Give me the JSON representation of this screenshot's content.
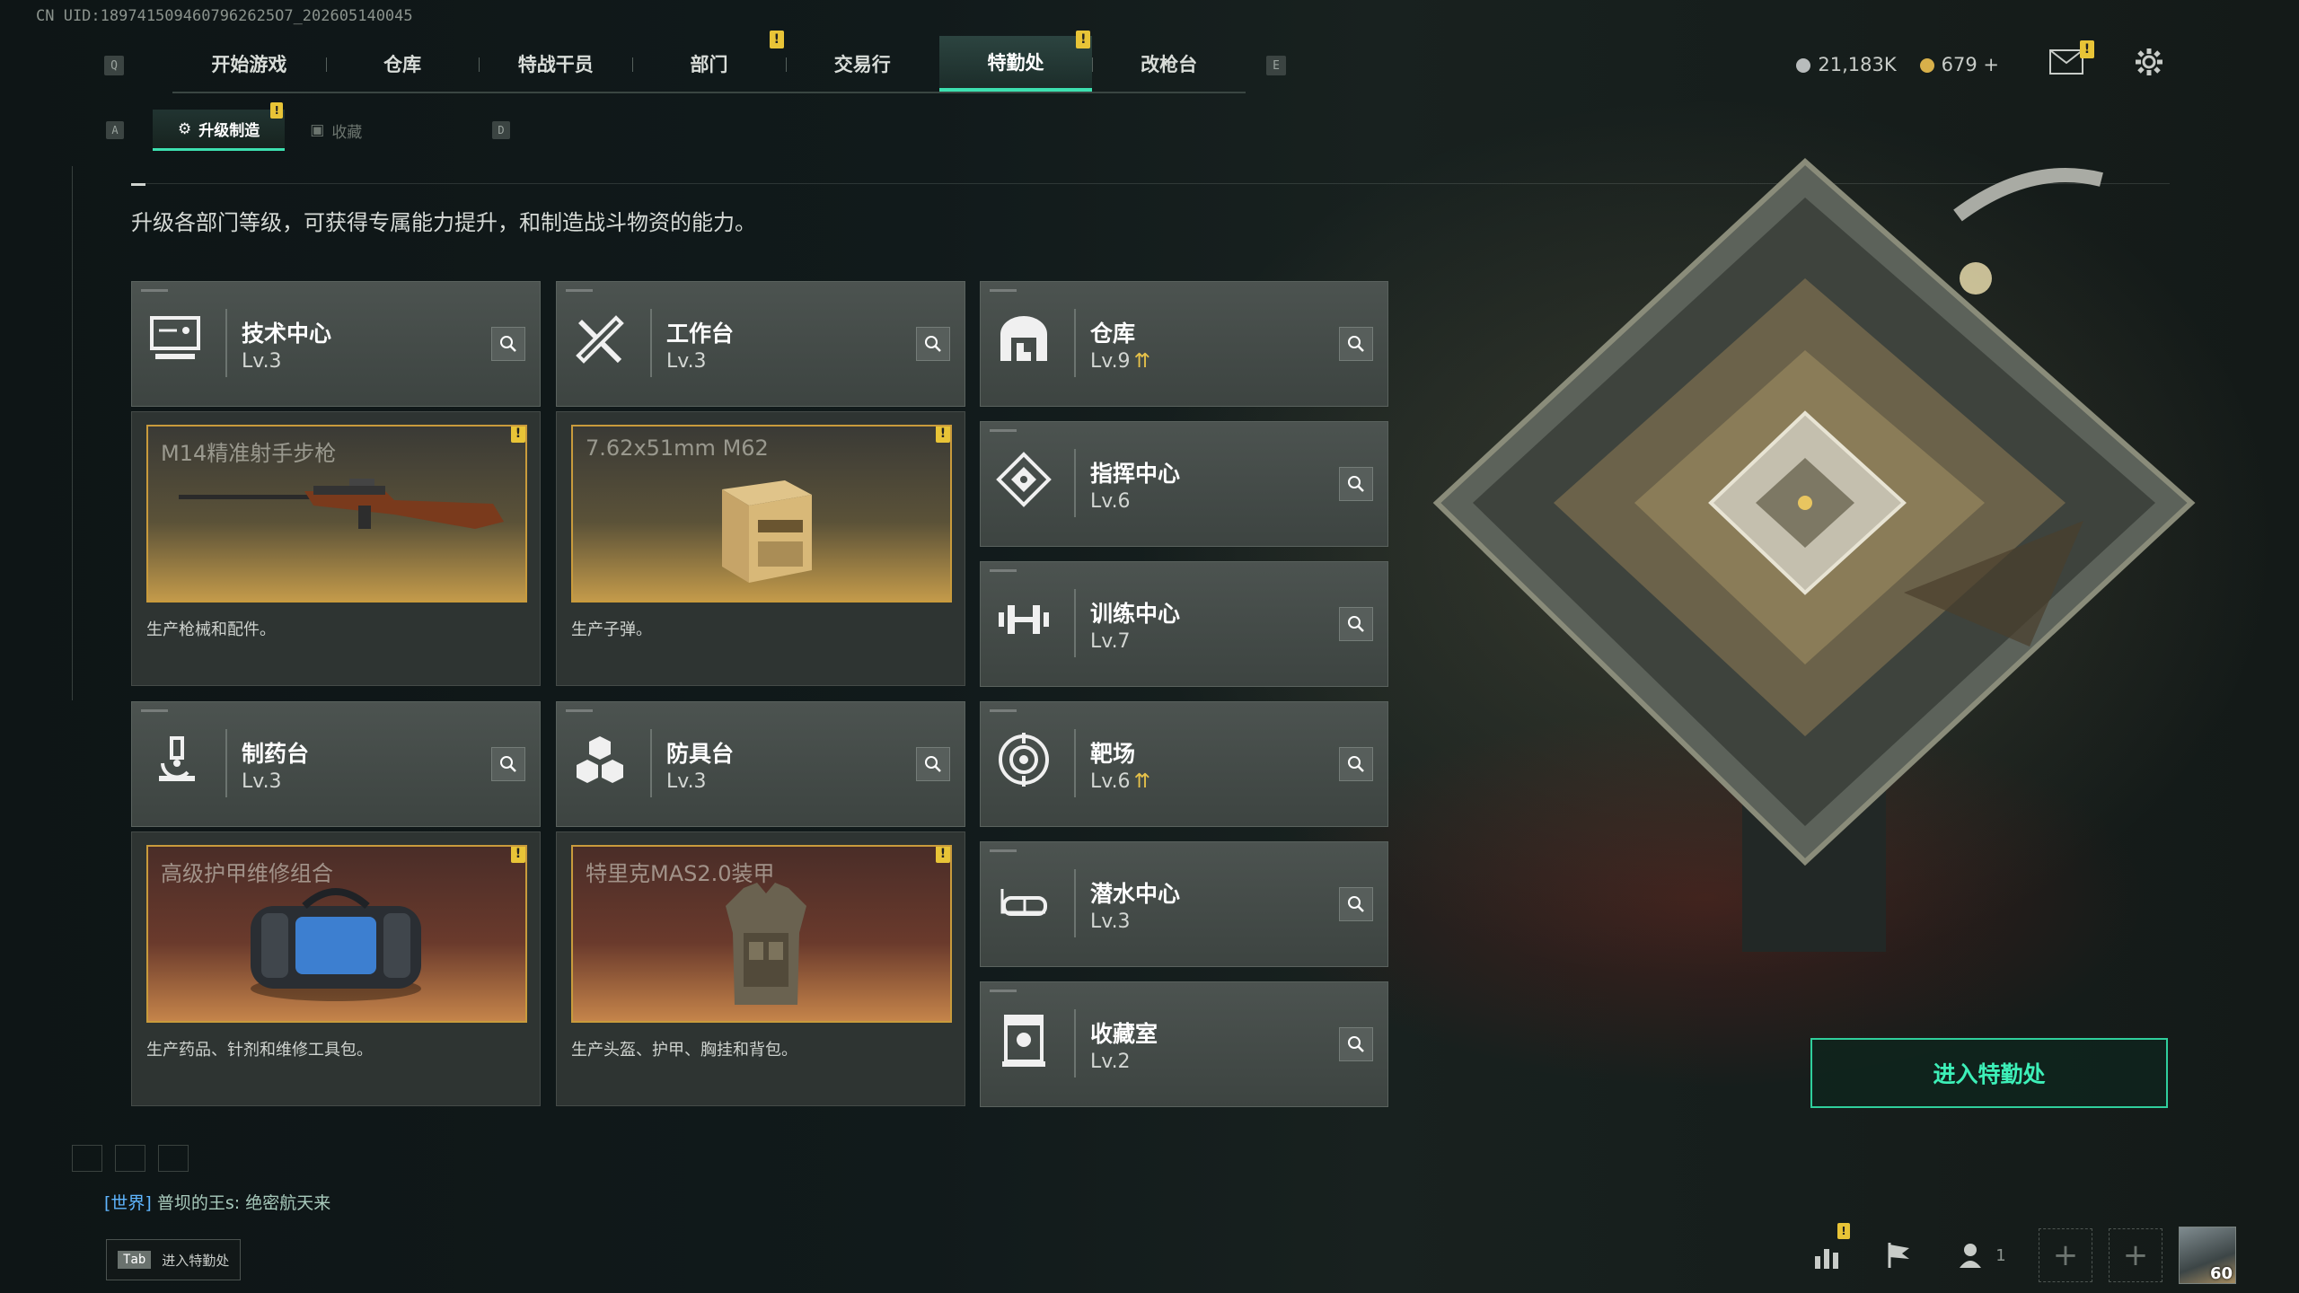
{
  "uid": "CN UID:1897415094607962625O7_202605140045",
  "top_nav": {
    "key_left": "Q",
    "key_right": "E",
    "tabs": [
      {
        "label": "开始游戏",
        "active": false,
        "badge": ""
      },
      {
        "label": "仓库",
        "active": false,
        "badge": ""
      },
      {
        "label": "特战干员",
        "active": false,
        "badge": ""
      },
      {
        "label": "部门",
        "active": false,
        "badge": "!"
      },
      {
        "label": "交易行",
        "active": false,
        "badge": ""
      },
      {
        "label": "特勤处",
        "active": true,
        "badge": "!"
      },
      {
        "label": "改枪台",
        "active": false,
        "badge": ""
      }
    ]
  },
  "currency": {
    "silver": "21,183K",
    "gold": "679",
    "plus": "+",
    "mail_badge": "!"
  },
  "sub_tabs": {
    "key_left": "A",
    "key_right": "D",
    "tabs": [
      {
        "label": "升级制造",
        "active": true,
        "badge": "!"
      },
      {
        "label": "收藏",
        "active": false,
        "badge": ""
      }
    ]
  },
  "description": "升级各部门等级，可获得专属能力提升，和制造战斗物资的能力。",
  "departments": {
    "tech": {
      "name": "技术中心",
      "level": "Lv.3",
      "icon": "monitor-icon"
    },
    "workbench": {
      "name": "工作台",
      "level": "Lv.3",
      "icon": "tools-icon"
    },
    "pharmacy": {
      "name": "制药台",
      "level": "Lv.3",
      "icon": "microscope-icon"
    },
    "armor": {
      "name": "防具台",
      "level": "Lv.3",
      "icon": "blocks-icon"
    },
    "warehouse": {
      "name": "仓库",
      "level": "Lv.9",
      "upgradable": true,
      "icon": "warehouse-icon"
    },
    "command": {
      "name": "指挥中心",
      "level": "Lv.6",
      "icon": "command-icon"
    },
    "training": {
      "name": "训练中心",
      "level": "Lv.7",
      "icon": "dumbbell-icon"
    },
    "range": {
      "name": "靶场",
      "level": "Lv.6",
      "upgradable": true,
      "icon": "target-icon"
    },
    "diving": {
      "name": "潜水中心",
      "level": "Lv.3",
      "icon": "goggles-icon"
    },
    "collection": {
      "name": "收藏室",
      "level": "Lv.2",
      "icon": "trophy-icon"
    }
  },
  "productions": {
    "tech": {
      "item": "M14精准射手步枪",
      "caption": "生产枪械和配件。",
      "badge": "!"
    },
    "workbench": {
      "item": "7.62x51mm M62",
      "caption": "生产子弹。",
      "badge": "!"
    },
    "pharmacy": {
      "item": "高级护甲维修组合",
      "caption": "生产药品、针剂和维修工具包。",
      "badge": "!"
    },
    "armor": {
      "item": "特里克MAS2.0装甲",
      "caption": "生产头盔、护甲、胸挂和背包。",
      "badge": "!"
    }
  },
  "enter_button": "进入特勤处",
  "chat": {
    "channel": "[世界]",
    "user": "普坝的王s:",
    "message": "绝密航天来"
  },
  "tab_hint": {
    "key": "Tab",
    "label": "进入特勤处"
  },
  "bottom": {
    "stats_badge": "!",
    "friends_count": "1",
    "player_level": "60"
  },
  "colors": {
    "accent": "#3de0b0",
    "badge": "#e8c437",
    "upgrade": "#e7c24a"
  }
}
